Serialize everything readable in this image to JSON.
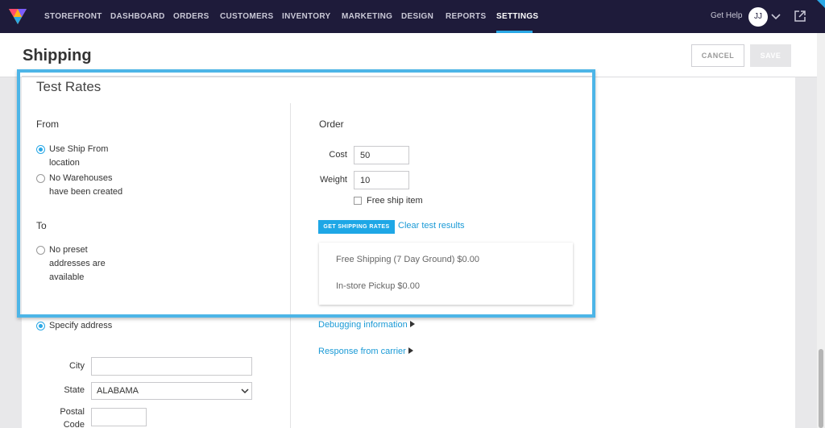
{
  "nav": {
    "items": [
      "STOREFRONT",
      "DASHBOARD",
      "ORDERS",
      "CUSTOMERS",
      "INVENTORY",
      "MARKETING",
      "DESIGN",
      "REPORTS",
      "SETTINGS"
    ],
    "active": "SETTINGS",
    "get_help": "Get Help",
    "avatar_initials": "JJ",
    "icons": [
      "logo-icon",
      "chevron-down-icon",
      "external-link-icon"
    ]
  },
  "header": {
    "title": "Shipping",
    "cancel_label": "CANCEL",
    "save_label": "SAVE"
  },
  "test_rates": {
    "title": "Test Rates",
    "from": {
      "heading": "From",
      "options": [
        {
          "line1": "Use Ship From",
          "line2": "location",
          "checked": true
        },
        {
          "line1": "No Warehouses",
          "line2": "have been created",
          "checked": false
        }
      ]
    },
    "to": {
      "heading": "To",
      "options": [
        {
          "line1": "No preset",
          "line2": "addresses are",
          "line3": "available",
          "checked": false
        },
        {
          "line1": "Specify address",
          "checked": true
        }
      ],
      "city_label": "City",
      "city_value": "",
      "state_label": "State",
      "state_value": "ALABAMA",
      "postal_label_1": "Postal",
      "postal_label_2": "Code",
      "postal_value": ""
    },
    "order": {
      "heading": "Order",
      "cost_label": "Cost",
      "cost_value": "50",
      "weight_label": "Weight",
      "weight_value": "10",
      "free_ship_label": "Free ship item",
      "free_ship_checked": false,
      "get_rates_label": "GET SHIPPING RATES",
      "clear_label": "Clear test results",
      "results": [
        "Free Shipping (7 Day Ground) $0.00",
        "In-store Pickup $0.00"
      ],
      "debugging_label": "Debugging information",
      "response_label": "Response from carrier"
    }
  },
  "colors": {
    "nav_bg": "#1e1b3a",
    "accent": "#2aa8e6",
    "link": "#1a9ad6",
    "highlight": "#4db5e7"
  }
}
